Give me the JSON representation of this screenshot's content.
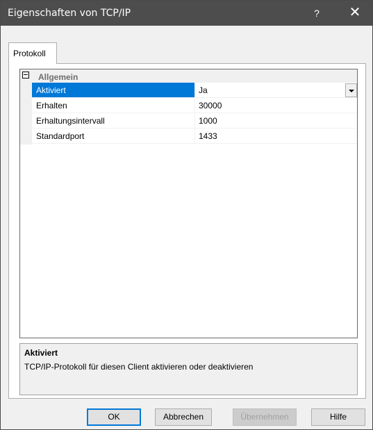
{
  "window": {
    "title": "Eigenschaften von TCP/IP",
    "help_glyph": "?",
    "close_glyph": "✕"
  },
  "tabs": [
    {
      "label": "Protokoll",
      "selected": true
    }
  ],
  "property_grid": {
    "category": {
      "label": "Allgemein",
      "expanded": true
    },
    "rows": [
      {
        "name": "Aktiviert",
        "value": "Ja",
        "selected": true,
        "has_dropdown": true
      },
      {
        "name": "Erhalten",
        "value": "30000",
        "selected": false,
        "has_dropdown": false
      },
      {
        "name": "Erhaltungsintervall",
        "value": "1000",
        "selected": false,
        "has_dropdown": false
      },
      {
        "name": "Standardport",
        "value": "1433",
        "selected": false,
        "has_dropdown": false
      }
    ]
  },
  "description": {
    "title": "Aktiviert",
    "text": "TCP/IP-Protokoll für diesen Client aktivieren oder deaktivieren"
  },
  "buttons": {
    "ok": "OK",
    "cancel": "Abbrechen",
    "apply": "Übernehmen",
    "help": "Hilfe"
  },
  "colors": {
    "titlebar": "#4d4d4d",
    "selection": "#0078d7",
    "face": "#f0f0f0"
  }
}
